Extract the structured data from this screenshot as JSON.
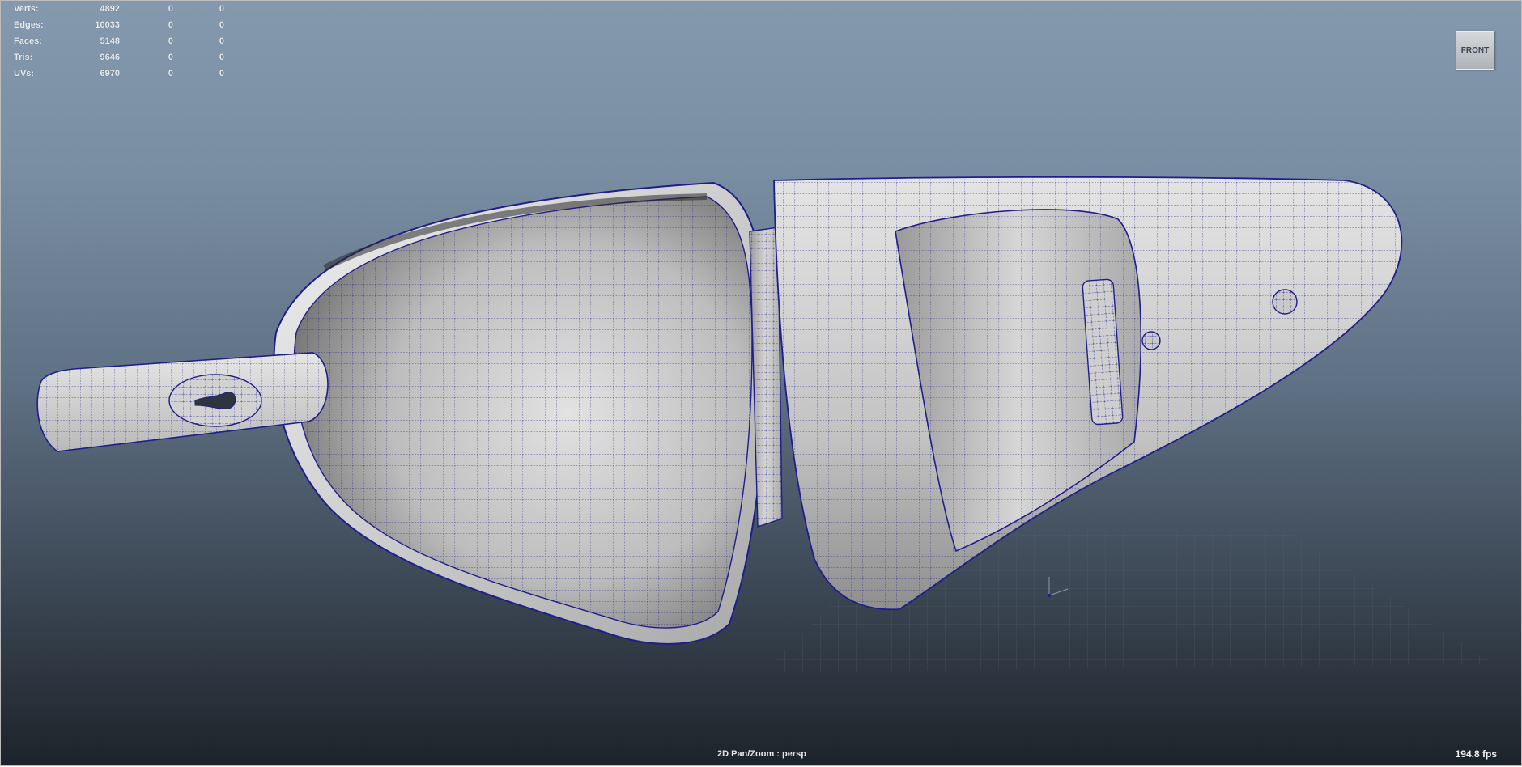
{
  "hud": {
    "rows": [
      {
        "label": "Verts:",
        "v1": "4892",
        "v2": "0",
        "v3": "0"
      },
      {
        "label": "Edges:",
        "v1": "10033",
        "v2": "0",
        "v3": "0"
      },
      {
        "label": "Faces:",
        "v1": "5148",
        "v2": "0",
        "v3": "0"
      },
      {
        "label": "Tris:",
        "v1": "9646",
        "v2": "0",
        "v3": "0"
      },
      {
        "label": "UVs:",
        "v1": "6970",
        "v2": "0",
        "v3": "0"
      }
    ]
  },
  "viewcube": {
    "label": "FRONT"
  },
  "status": {
    "mode": "2D Pan/Zoom : persp",
    "fps": "194.8 fps"
  },
  "colors": {
    "wireframe": "#1e1e8c",
    "background_top": "#8499ae",
    "background_bottom": "#1d232a"
  }
}
